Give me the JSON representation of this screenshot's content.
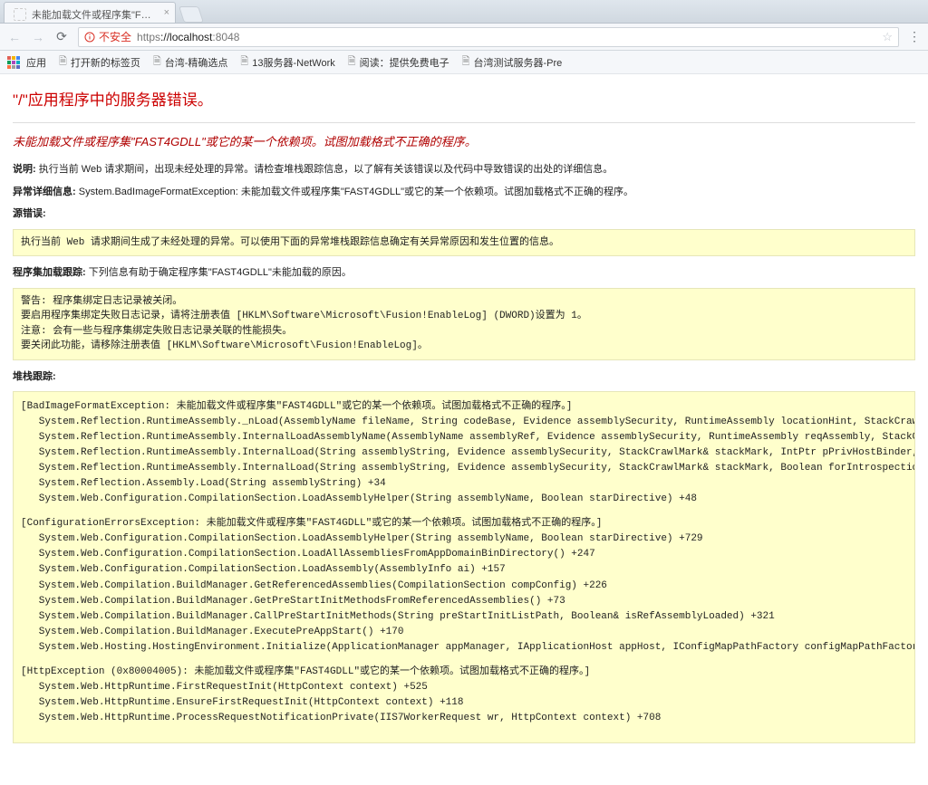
{
  "browser": {
    "tab_title": "未能加载文件或程序集\"F…",
    "url_proto": "https",
    "url_host": "://localhost",
    "url_port": ":8048",
    "insecure_label": "不安全"
  },
  "bookmarks": {
    "apps": "应用",
    "items": [
      "打开新的标签页",
      "台湾-精确选点",
      "13服务器-NetWork",
      "阅读：提供免费电子",
      "台湾测试服务器-Pre"
    ]
  },
  "ysod": {
    "h1": "\"/\"应用程序中的服务器错误。",
    "h2": "未能加载文件或程序集\"FAST4GDLL\"或它的某一个依赖项。试图加载格式不正确的程序。",
    "desc_label": "说明:",
    "desc_text": " 执行当前 Web 请求期间，出现未经处理的异常。请检查堆栈跟踪信息，以了解有关该错误以及代码中导致错误的出处的详细信息。",
    "exc_label": "异常详细信息:",
    "exc_text": " System.BadImageFormatException: 未能加载文件或程序集\"FAST4GDLL\"或它的某一个依赖项。试图加载格式不正确的程序。",
    "src_label": "源错误:",
    "src_box": "执行当前 Web 请求期间生成了未经处理的异常。可以使用下面的异常堆栈跟踪信息确定有关异常原因和发生位置的信息。",
    "asm_label": "程序集加载跟踪:",
    "asm_text": " 下列信息有助于确定程序集\"FAST4GDLL\"未能加载的原因。",
    "asm_box": "警告: 程序集绑定日志记录被关闭。\n要启用程序集绑定失败日志记录，请将注册表值 [HKLM\\Software\\Microsoft\\Fusion!EnableLog] (DWORD)设置为 1。\n注意: 会有一些与程序集绑定失败日志记录关联的性能损失。\n要关闭此功能，请移除注册表值 [HKLM\\Software\\Microsoft\\Fusion!EnableLog]。",
    "trace_label": "堆栈跟踪:",
    "trace_groups": [
      "[BadImageFormatException: 未能加载文件或程序集\"FAST4GDLL\"或它的某一个依赖项。试图加载格式不正确的程序。]\n   System.Reflection.RuntimeAssembly._nLoad(AssemblyName fileName, String codeBase, Evidence assemblySecurity, RuntimeAssembly locationHint, StackCrawlMark& stackMark, IntPtr pPrivHo\n   System.Reflection.RuntimeAssembly.InternalLoadAssemblyName(AssemblyName assemblyRef, Evidence assemblySecurity, RuntimeAssembly reqAssembly, StackCrawlMark& stackMark, IntPtr pPri\n   System.Reflection.RuntimeAssembly.InternalLoad(String assemblyString, Evidence assemblySecurity, StackCrawlMark& stackMark, IntPtr pPrivHostBinder, Boolean forIntrospection) +110\n   System.Reflection.RuntimeAssembly.InternalLoad(String assemblyString, Evidence assemblySecurity, StackCrawlMark& stackMark, Boolean forIntrospection) +22\n   System.Reflection.Assembly.Load(String assemblyString) +34\n   System.Web.Configuration.CompilationSection.LoadAssemblyHelper(String assemblyName, Boolean starDirective) +48",
      "[ConfigurationErrorsException: 未能加载文件或程序集\"FAST4GDLL\"或它的某一个依赖项。试图加载格式不正确的程序。]\n   System.Web.Configuration.CompilationSection.LoadAssemblyHelper(String assemblyName, Boolean starDirective) +729\n   System.Web.Configuration.CompilationSection.LoadAllAssembliesFromAppDomainBinDirectory() +247\n   System.Web.Configuration.CompilationSection.LoadAssembly(AssemblyInfo ai) +157\n   System.Web.Compilation.BuildManager.GetReferencedAssemblies(CompilationSection compConfig) +226\n   System.Web.Compilation.BuildManager.GetPreStartInitMethodsFromReferencedAssemblies() +73\n   System.Web.Compilation.BuildManager.CallPreStartInitMethods(String preStartInitListPath, Boolean& isRefAssemblyLoaded) +321\n   System.Web.Compilation.BuildManager.ExecutePreAppStart() +170\n   System.Web.Hosting.HostingEnvironment.Initialize(ApplicationManager appManager, IApplicationHost appHost, IConfigMapPathFactory configMapPathFactory, HostingEnvironmentParameters",
      "[HttpException (0x80004005): 未能加载文件或程序集\"FAST4GDLL\"或它的某一个依赖项。试图加载格式不正确的程序。]\n   System.Web.HttpRuntime.FirstRequestInit(HttpContext context) +525\n   System.Web.HttpRuntime.EnsureFirstRequestInit(HttpContext context) +118\n   System.Web.HttpRuntime.ProcessRequestNotificationPrivate(IIS7WorkerRequest wr, HttpContext context) +708"
    ]
  }
}
